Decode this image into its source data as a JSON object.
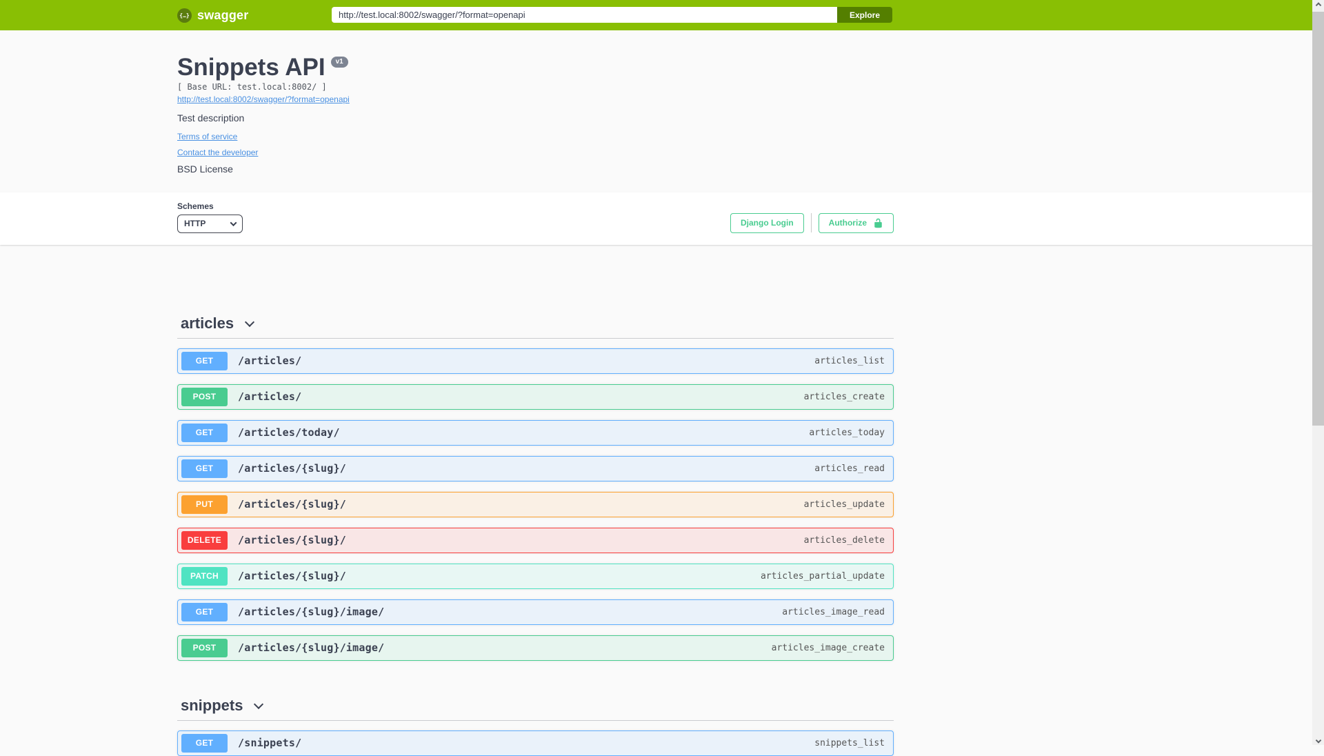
{
  "topbar": {
    "logo_text": "swagger",
    "logo_glyph": "{…}",
    "url_value": "http://test.local:8002/swagger/?format=openapi",
    "explore_label": "Explore"
  },
  "colors": {
    "topbar_bg": "#89bf04",
    "explore_bg": "#547f00",
    "link_blue": "#4990e2",
    "text_dark": "#3b4151",
    "auth_green": "#49cc90",
    "methods": {
      "GET": "#61affe",
      "POST": "#49cc90",
      "PUT": "#fca130",
      "DELETE": "#f93e3e",
      "PATCH": "#50e3c2"
    }
  },
  "info": {
    "title": "Snippets API",
    "version_badge": "v1",
    "base_url_line": "[ Base URL: test.local:8002/ ]",
    "spec_link": "http://test.local:8002/swagger/?format=openapi",
    "description": "Test description",
    "terms_link": "Terms of service",
    "contact_link": "Contact the developer",
    "license_text": "BSD License"
  },
  "scheme_bar": {
    "schemes_label": "Schemes",
    "scheme_selected": "HTTP",
    "django_login_label": "Django Login",
    "authorize_label": "Authorize"
  },
  "sections": [
    {
      "name": "articles",
      "operations": [
        {
          "method": "GET",
          "path": "/articles/",
          "operation_id": "articles_list"
        },
        {
          "method": "POST",
          "path": "/articles/",
          "operation_id": "articles_create"
        },
        {
          "method": "GET",
          "path": "/articles/today/",
          "operation_id": "articles_today"
        },
        {
          "method": "GET",
          "path": "/articles/{slug}/",
          "operation_id": "articles_read"
        },
        {
          "method": "PUT",
          "path": "/articles/{slug}/",
          "operation_id": "articles_update"
        },
        {
          "method": "DELETE",
          "path": "/articles/{slug}/",
          "operation_id": "articles_delete"
        },
        {
          "method": "PATCH",
          "path": "/articles/{slug}/",
          "operation_id": "articles_partial_update"
        },
        {
          "method": "GET",
          "path": "/articles/{slug}/image/",
          "operation_id": "articles_image_read"
        },
        {
          "method": "POST",
          "path": "/articles/{slug}/image/",
          "operation_id": "articles_image_create"
        }
      ]
    },
    {
      "name": "snippets",
      "operations": [
        {
          "method": "GET",
          "path": "/snippets/",
          "operation_id": "snippets_list"
        }
      ]
    }
  ]
}
